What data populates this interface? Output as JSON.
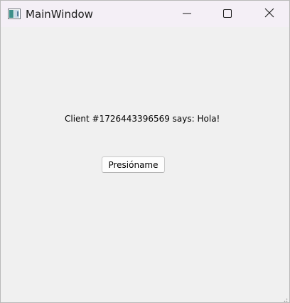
{
  "window": {
    "title": "MainWindow",
    "controls": {
      "minimize": "minimize-icon",
      "maximize": "maximize-icon",
      "close": "close-icon"
    }
  },
  "content": {
    "message": "Client #1726443396569 says: Hola!",
    "button_label": "Presióname"
  },
  "colors": {
    "titlebar": "#f4eff6",
    "client_background": "#f0f0f0",
    "button_background": "#fdfdfd",
    "button_border": "#c8c8c8"
  }
}
